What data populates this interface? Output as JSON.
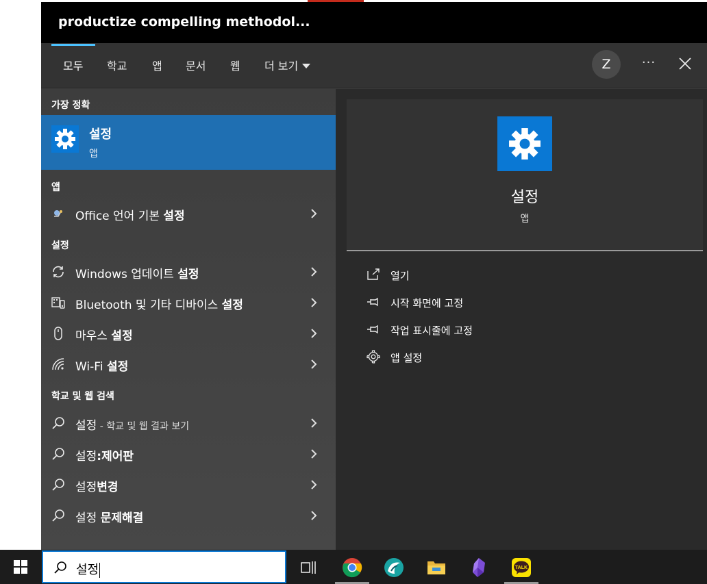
{
  "window": {
    "title": "productize compelling methodol..."
  },
  "tabs": [
    {
      "label": "모두",
      "active": true
    },
    {
      "label": "학교"
    },
    {
      "label": "앱"
    },
    {
      "label": "문서"
    },
    {
      "label": "웹"
    },
    {
      "label": "더 보기"
    }
  ],
  "header": {
    "avatar_initial": "Z",
    "more_label": "···"
  },
  "sections": {
    "best_match": "가장 정확",
    "apps": "앱",
    "settings": "설정",
    "web": "학교 및 웹 검색"
  },
  "best_match": {
    "title": "설정",
    "subtitle": "앱"
  },
  "apps": [
    {
      "prefix": "Office 언어 기본 ",
      "bold": "설정"
    }
  ],
  "settings": [
    {
      "prefix": "Windows 업데이트 ",
      "bold": "설정",
      "icon": "sync-icon"
    },
    {
      "prefix": "Bluetooth 및 기타 디바이스 ",
      "bold": "설정",
      "icon": "devices-icon"
    },
    {
      "prefix": "마우스 ",
      "bold": "설정",
      "icon": "mouse-icon"
    },
    {
      "prefix": "Wi-Fi ",
      "bold": "설정",
      "icon": "wifi-icon"
    }
  ],
  "web": [
    {
      "prefix": "설정",
      "small": " - 학교 및 웹 결과 보기",
      "bold": ""
    },
    {
      "prefix": "설정",
      "small": "",
      "bold": ":제어판"
    },
    {
      "prefix": "설정",
      "small": "",
      "bold": "변경"
    },
    {
      "prefix": "설정 ",
      "small": "",
      "bold": "문제해결"
    }
  ],
  "preview": {
    "title": "설정",
    "subtitle": "앱",
    "actions": [
      {
        "label": "열기",
        "icon": "open-icon"
      },
      {
        "label": "시작 화면에 고정",
        "icon": "pin-icon"
      },
      {
        "label": "작업 표시줄에 고정",
        "icon": "pin-icon"
      },
      {
        "label": "앱 설정",
        "icon": "gear-icon"
      }
    ]
  },
  "taskbar": {
    "search_value": "설정",
    "apps": [
      "task-view-icon",
      "chrome-icon",
      "app-icon",
      "file-explorer-icon",
      "obsidian-icon",
      "kakaotalk-icon"
    ],
    "kakao_label": "TALK"
  },
  "colors": {
    "accent": "#0a78d4",
    "selected_row": "#1f6fb2",
    "tab_underline": "#4cc2ff"
  }
}
